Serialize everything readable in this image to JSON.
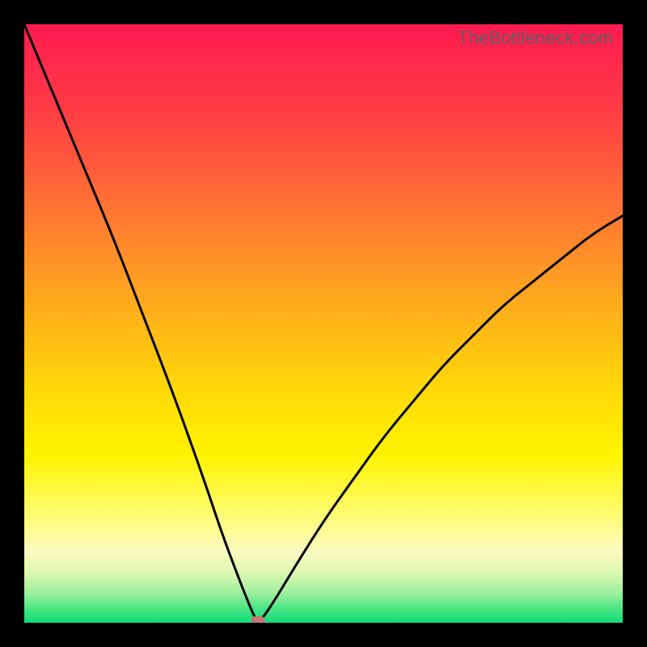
{
  "watermark": "TheBottleneck.com",
  "colors": {
    "frame": "#000000",
    "curve": "#000000",
    "marker": "#c77777",
    "gradient_stops": [
      {
        "pct": 0,
        "color": "#ff1a51"
      },
      {
        "pct": 14,
        "color": "#ff3b44"
      },
      {
        "pct": 30,
        "color": "#ff7134"
      },
      {
        "pct": 45,
        "color": "#ffa51f"
      },
      {
        "pct": 60,
        "color": "#ffd60a"
      },
      {
        "pct": 72,
        "color": "#fff400"
      },
      {
        "pct": 82,
        "color": "#fdfc72"
      },
      {
        "pct": 88,
        "color": "#fbfbc0"
      },
      {
        "pct": 92,
        "color": "#d8f7b0"
      },
      {
        "pct": 95,
        "color": "#9ef09e"
      },
      {
        "pct": 98,
        "color": "#40e47f"
      },
      {
        "pct": 100,
        "color": "#0fdc78"
      }
    ]
  },
  "chart_data": {
    "type": "line",
    "title": "",
    "xlabel": "",
    "ylabel": "",
    "xlim": [
      0,
      100
    ],
    "ylim": [
      0,
      100
    ],
    "optimum_x": 39,
    "marker": {
      "x": 39,
      "y": 0
    },
    "series": [
      {
        "name": "bottleneck-curve",
        "x": [
          0,
          5,
          10,
          15,
          20,
          25,
          30,
          33,
          36,
          38,
          39,
          40,
          42,
          45,
          50,
          55,
          60,
          65,
          70,
          75,
          80,
          85,
          90,
          95,
          100
        ],
        "values": [
          100,
          88,
          76,
          64,
          51,
          38,
          24,
          15,
          7,
          2,
          0,
          1,
          4,
          9,
          17,
          24,
          31,
          37,
          43,
          48,
          53,
          57,
          61,
          65,
          68
        ]
      }
    ]
  }
}
